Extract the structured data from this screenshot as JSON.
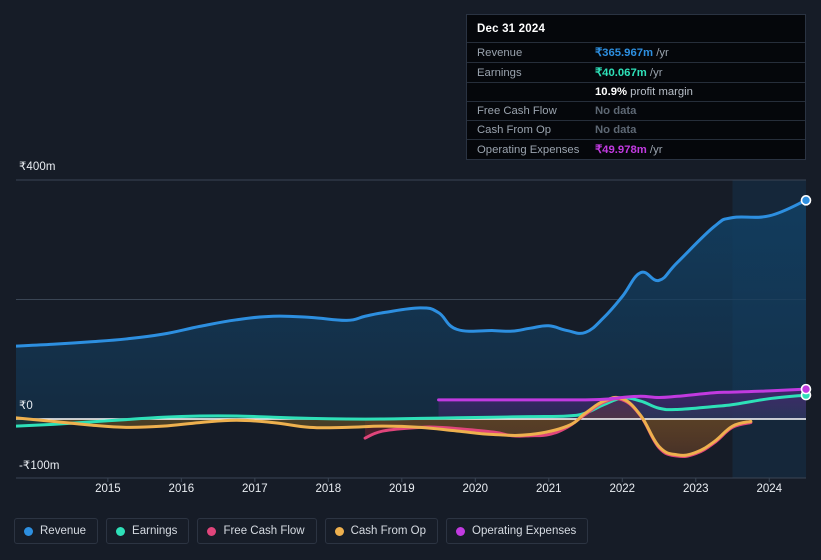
{
  "tooltip": {
    "date": "Dec 31 2024",
    "rows": [
      {
        "label": "Revenue",
        "value": "₹365.967m",
        "unit": "/yr",
        "color": "#2d8fe0",
        "nodata": false
      },
      {
        "label": "Earnings",
        "value": "₹40.067m",
        "unit": "/yr",
        "color": "#2ee0b8",
        "nodata": false
      },
      {
        "label": "",
        "value": "10.9%",
        "unit": "profit margin",
        "color": "#ffffff",
        "nodata": false,
        "margin": true
      },
      {
        "label": "Free Cash Flow",
        "value": "No data",
        "unit": "",
        "color": "#5d6773",
        "nodata": true
      },
      {
        "label": "Cash From Op",
        "value": "No data",
        "unit": "",
        "color": "#5d6773",
        "nodata": true
      },
      {
        "label": "Operating Expenses",
        "value": "₹49.978m",
        "unit": "/yr",
        "color": "#c13ae0",
        "nodata": false
      }
    ]
  },
  "axes": {
    "y_ticks": [
      {
        "label": "₹400m",
        "value": 400
      },
      {
        "label": "₹0",
        "value": 0
      },
      {
        "label": "-₹100m",
        "value": -100
      }
    ],
    "x_ticks": [
      "2015",
      "2016",
      "2017",
      "2018",
      "2019",
      "2020",
      "2021",
      "2022",
      "2023",
      "2024"
    ],
    "ylim": [
      -125,
      400
    ],
    "currency": "₹",
    "unit": "m"
  },
  "legend": [
    {
      "label": "Revenue",
      "color": "#2d8fe0"
    },
    {
      "label": "Earnings",
      "color": "#2ee0b8"
    },
    {
      "label": "Free Cash Flow",
      "color": "#e0457b"
    },
    {
      "label": "Cash From Op",
      "color": "#eeb04e"
    },
    {
      "label": "Operating Expenses",
      "color": "#c13ae0"
    }
  ],
  "chart_data": {
    "type": "area",
    "title": "",
    "xlabel": "",
    "ylabel": "",
    "ylim": [
      -125,
      400
    ],
    "xlim": [
      2014.25,
      2025.0
    ],
    "grid": true,
    "legend_position": "bottom-left",
    "forecast_start": 2024.0,
    "series": [
      {
        "name": "Revenue",
        "color": "#2d8fe0",
        "fill": "#123d5f",
        "x": [
          2014.25,
          2014.75,
          2015.25,
          2015.75,
          2016.25,
          2016.75,
          2017.25,
          2017.75,
          2018.25,
          2018.75,
          2019.0,
          2019.25,
          2019.75,
          2020.0,
          2020.25,
          2020.75,
          2021.0,
          2021.25,
          2021.5,
          2021.75,
          2022.0,
          2022.25,
          2022.5,
          2022.75,
          2023.0,
          2023.25,
          2023.75,
          2024.0,
          2024.5,
          2025.0
        ],
        "y": [
          122,
          125,
          129,
          134,
          142,
          155,
          166,
          172,
          170,
          165,
          172,
          178,
          186,
          178,
          150,
          148,
          147,
          152,
          156,
          148,
          145,
          170,
          205,
          245,
          232,
          262,
          322,
          337,
          340,
          366
        ]
      },
      {
        "name": "Earnings",
        "color": "#2ee0b8",
        "fill": "#1b4c4c",
        "x": [
          2014.25,
          2014.75,
          2015.25,
          2015.75,
          2016.25,
          2016.75,
          2017.25,
          2017.75,
          2018.25,
          2018.75,
          2019.25,
          2019.75,
          2020.25,
          2020.75,
          2021.25,
          2021.75,
          2022.0,
          2022.25,
          2022.5,
          2022.75,
          2023.0,
          2023.25,
          2023.75,
          2024.0,
          2024.5,
          2025.0
        ],
        "y": [
          -12,
          -9,
          -5,
          -1,
          3,
          5,
          5,
          3,
          1,
          0,
          0,
          1,
          2,
          3,
          4,
          5,
          10,
          24,
          35,
          30,
          18,
          16,
          21,
          24,
          34,
          40
        ]
      },
      {
        "name": "Free Cash Flow",
        "color": "#e0457b",
        "fill": "#5e1f2b",
        "x": [
          2019.0,
          2019.25,
          2019.75,
          2020.0,
          2020.25,
          2020.75,
          2021.0,
          2021.25,
          2021.5,
          2021.75,
          2022.0,
          2022.25,
          2022.5,
          2022.75,
          2023.0,
          2023.25,
          2023.5,
          2023.75,
          2024.0,
          2024.25
        ],
        "y": [
          -32,
          -20,
          -14,
          -14,
          -16,
          -22,
          -28,
          -28,
          -26,
          -14,
          8,
          28,
          32,
          5,
          -48,
          -62,
          -58,
          -40,
          -14,
          -6
        ]
      },
      {
        "name": "Cash From Op",
        "color": "#eeb04e",
        "fill": "#5b4a25",
        "x": [
          2014.25,
          2014.75,
          2015.25,
          2015.75,
          2016.25,
          2016.75,
          2017.25,
          2017.75,
          2018.25,
          2018.75,
          2019.25,
          2019.75,
          2020.25,
          2020.75,
          2021.25,
          2021.75,
          2022.0,
          2022.25,
          2022.5,
          2022.75,
          2023.0,
          2023.25,
          2023.5,
          2023.75,
          2024.0,
          2024.25
        ],
        "y": [
          2,
          -4,
          -10,
          -14,
          -12,
          -6,
          -2,
          -6,
          -14,
          -14,
          -12,
          -14,
          -20,
          -26,
          -26,
          -12,
          10,
          30,
          34,
          6,
          -46,
          -60,
          -56,
          -38,
          -12,
          -4
        ]
      },
      {
        "name": "Operating Expenses",
        "color": "#c13ae0",
        "fill": "#40256b",
        "x": [
          2020.0,
          2020.5,
          2021.0,
          2021.5,
          2022.0,
          2022.25,
          2022.5,
          2022.75,
          2023.0,
          2023.25,
          2023.75,
          2024.0,
          2024.5,
          2025.0
        ],
        "y": [
          32,
          32,
          32,
          32,
          32,
          33,
          36,
          38,
          36,
          38,
          44,
          45,
          47,
          50
        ]
      }
    ]
  }
}
